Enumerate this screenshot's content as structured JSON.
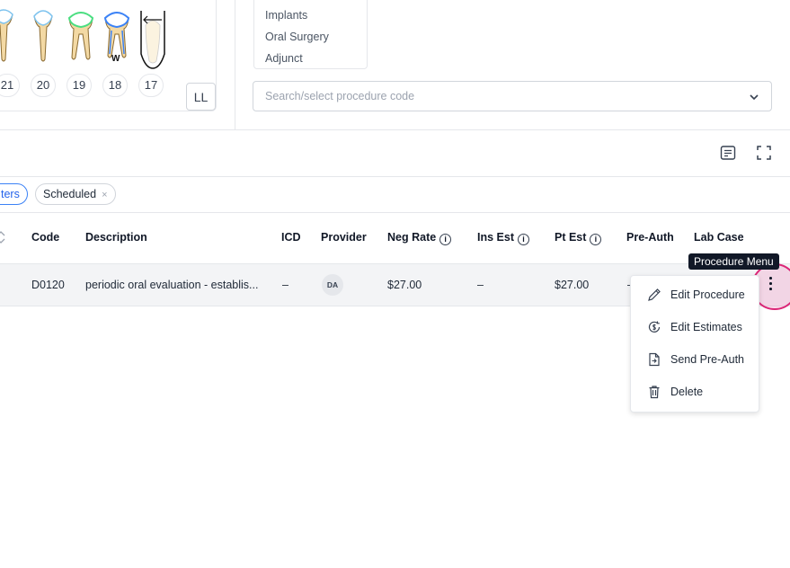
{
  "tooth_chart": {
    "tooth_numbers": [
      "21",
      "20",
      "19",
      "18",
      "17"
    ],
    "marker": "W",
    "quadrant_label": "LL"
  },
  "procedure_categories": {
    "items": [
      "Implants",
      "Oral Surgery",
      "Adjunct"
    ]
  },
  "procedure_search": {
    "placeholder": "Search/select procedure code"
  },
  "filters": {
    "filters_chip": "ters",
    "scheduled_chip": "Scheduled",
    "chip_close": "×"
  },
  "table": {
    "headers": {
      "code": "Code",
      "description": "Description",
      "icd": "ICD",
      "provider": "Provider",
      "neg_rate": "Neg Rate",
      "ins_est": "Ins Est",
      "pt_est": "Pt Est",
      "pre_auth": "Pre-Auth",
      "lab_case": "Lab Case"
    },
    "info_glyph": "i",
    "row": {
      "code": "D0120",
      "description": "periodic oral evaluation - establis...",
      "icd": "–",
      "provider_initials": "DA",
      "neg_rate": "$27.00",
      "ins_est": "–",
      "pt_est": "$27.00",
      "pre_auth": "–"
    }
  },
  "tooltip": "Procedure Menu",
  "procedure_menu": {
    "items": [
      "Edit Procedure",
      "Edit Estimates",
      "Send Pre-Auth",
      "Delete"
    ]
  },
  "colors": {
    "accent": "#2563eb",
    "highlight": "#db2777"
  }
}
